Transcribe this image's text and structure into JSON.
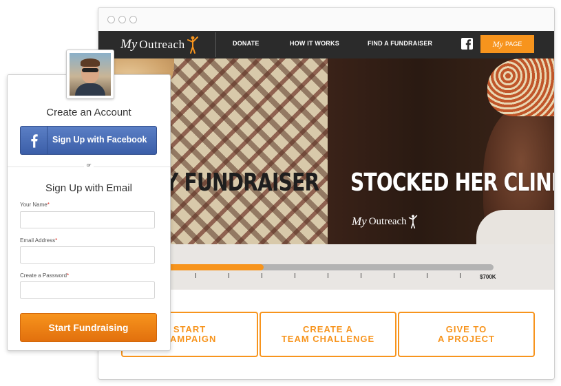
{
  "nav": {
    "logo_my": "My",
    "logo_outreach": "Outreach",
    "links": [
      "DONATE",
      "HOW IT WORKS",
      "FIND A FUNDRAISER"
    ],
    "facebook_icon": "facebook-icon",
    "mypage_my": "My",
    "mypage_label": "PAGE"
  },
  "hero": {
    "left_text": "Y FUNDRAISER",
    "right_text": "STOCKED HER CLINIC.",
    "logo_my": "My",
    "logo_outreach": "Outreach"
  },
  "progress": {
    "fraction": 0.31,
    "goal_label": "$700K"
  },
  "cta": {
    "start_campaign": [
      "START",
      "CAMPAIGN"
    ],
    "team_challenge": [
      "CREATE A",
      "TEAM CHALLENGE"
    ],
    "give_project": [
      "GIVE TO",
      "A PROJECT"
    ]
  },
  "signup": {
    "title": "Create an Account",
    "facebook_button": "Sign Up with Facebook",
    "or": "or",
    "email_title": "Sign Up with Email",
    "name_label": "Your Name",
    "email_label": "Email Address",
    "password_label": "Create a Password",
    "required_mark": "*",
    "submit": "Start Fundraising"
  },
  "colors": {
    "accent": "#f7941d",
    "facebook": "#3b5ea8",
    "nav_bg": "#2b2b2b"
  }
}
